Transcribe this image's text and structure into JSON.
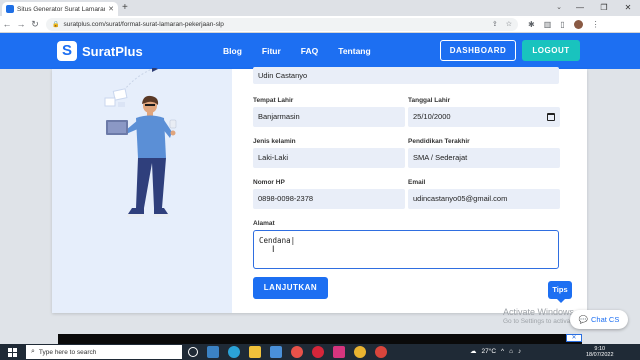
{
  "browser": {
    "tab_title": "Situs Generator Surat Lamaran P",
    "url": "suratplus.com/surat/format-surat-lamaran-pekerjaan-slp",
    "window_controls": [
      "—",
      "❐",
      "✕"
    ]
  },
  "site": {
    "logo_text": "SuratPlus",
    "logo_mark": "S",
    "nav": [
      "Blog",
      "Fitur",
      "FAQ",
      "Tentang"
    ],
    "dashboard_label": "DASHBOARD",
    "logout_label": "LOGOUT",
    "accent": "#1d6ff2",
    "logout_color": "#19c3be"
  },
  "form": {
    "name_value": "Udin Castanyo",
    "tempat_lahir_label": "Tempat Lahir",
    "tempat_lahir_value": "Banjarmasin",
    "tanggal_lahir_label": "Tanggal Lahir",
    "tanggal_lahir_value": "25/10/2000",
    "jenis_kelamin_label": "Jenis kelamin",
    "jenis_kelamin_value": "Laki-Laki",
    "pendidikan_label": "Pendidikan Terakhir",
    "pendidikan_value": "SMA / Sederajat",
    "nomor_hp_label": "Nomor HP",
    "nomor_hp_value": "0898-0098-2378",
    "email_label": "Email",
    "email_value": "udincastanyo05@gmail.com",
    "alamat_label": "Alamat",
    "alamat_value": "Cendana",
    "submit_label": "LANJUTKAN"
  },
  "widgets": {
    "tips_label": "Tips",
    "chat_label": "Chat CS",
    "activate_line1": "Activate Windows",
    "activate_line2": "Go to Settings to activate Windows."
  },
  "taskbar": {
    "search_placeholder": "Type here to search",
    "weather": "27°C",
    "time": "9:10",
    "date": "18/07/2022"
  }
}
